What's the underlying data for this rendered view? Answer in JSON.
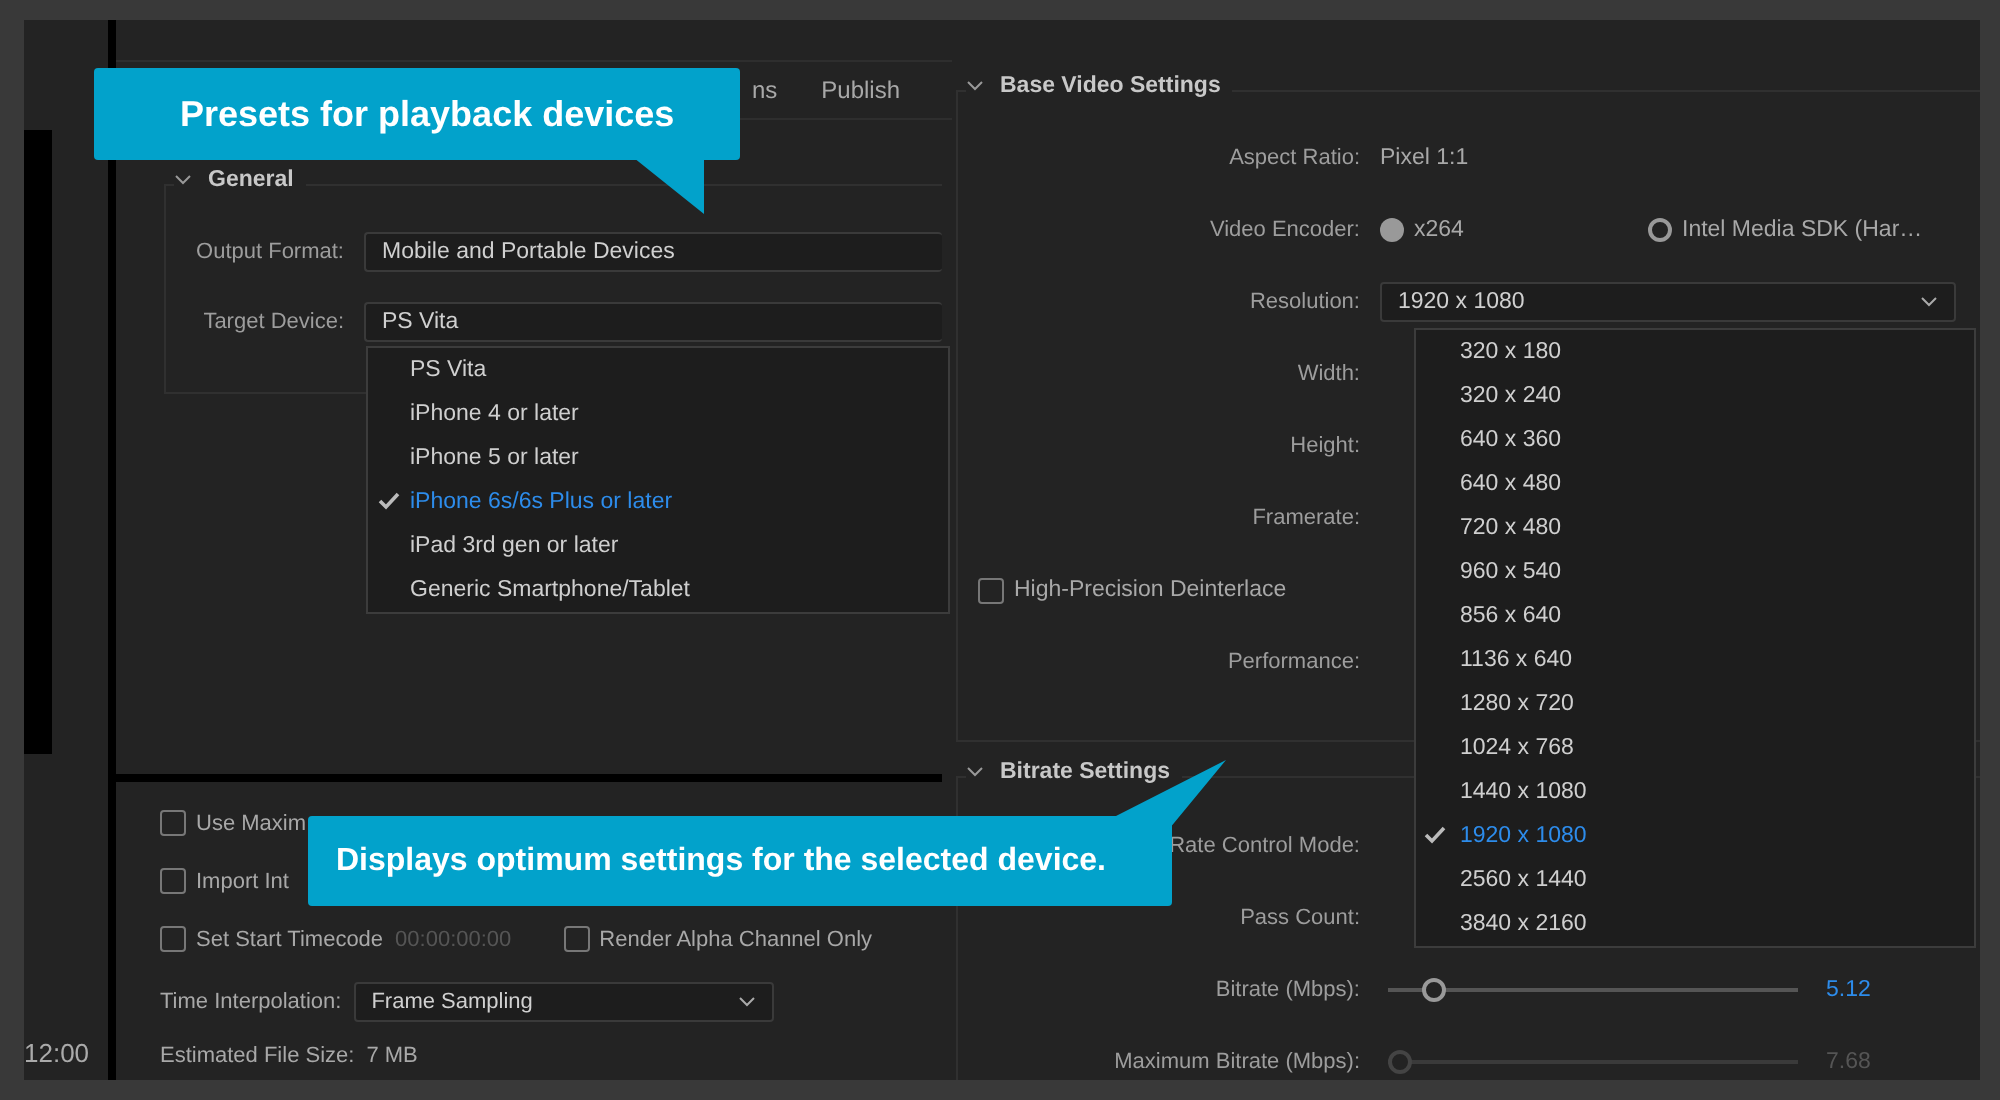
{
  "tabs": [
    {
      "label": "ns"
    },
    {
      "label": "Publish"
    }
  ],
  "general": {
    "title": "General",
    "expanded": true,
    "rows": [
      {
        "label": "Output Format:",
        "value": "Mobile and Portable Devices"
      },
      {
        "label": "Target Device:",
        "value": "PS Vita"
      }
    ]
  },
  "device_menu": [
    {
      "label": "PS Vita",
      "selected": false
    },
    {
      "label": "iPhone 4 or later",
      "selected": false
    },
    {
      "label": "iPhone 5 or later",
      "selected": false
    },
    {
      "label": "iPhone 6s/6s Plus or later",
      "selected": true
    },
    {
      "label": "iPad 3rd gen or later",
      "selected": false
    },
    {
      "label": "Generic Smartphone/Tablet",
      "selected": false
    }
  ],
  "export_options": [
    {
      "label": "Use Maxim",
      "checked": false
    },
    {
      "label": "Import Int",
      "checked": false
    },
    {
      "label": "Set Start Timecode",
      "checked": false,
      "value": "00:00:00:00"
    },
    {
      "label": "Render Alpha Channel Only",
      "checked": false
    }
  ],
  "time_interpolation": {
    "label": "Time Interpolation:",
    "value": "Frame Sampling"
  },
  "estimated_file_size": {
    "label": "Estimated File Size:",
    "value": "7 MB"
  },
  "timecode": "12:00",
  "video": {
    "title": "Base Video Settings",
    "expanded": true,
    "rows": [
      {
        "kind": "text",
        "label": "Aspect Ratio:",
        "value": "Pixel 1:1"
      },
      {
        "kind": "radio",
        "label": "Video Encoder:",
        "options": [
          {
            "label": "x264",
            "selected": true
          },
          {
            "label": "Intel Media SDK (Har…",
            "selected": false
          }
        ]
      },
      {
        "kind": "select",
        "label": "Resolution:",
        "value": "1920 x 1080"
      },
      {
        "kind": "blank",
        "label": "Width:"
      },
      {
        "kind": "blank",
        "label": "Height:"
      },
      {
        "kind": "blank",
        "label": "Framerate:"
      },
      {
        "kind": "checkbox",
        "label": "High-Precision Deinterlace",
        "checked": false
      },
      {
        "kind": "blank",
        "label": "Performance:"
      }
    ]
  },
  "resolution_menu": [
    {
      "label": "320 x 180",
      "selected": false
    },
    {
      "label": "320 x 240",
      "selected": false
    },
    {
      "label": "640 x 360",
      "selected": false
    },
    {
      "label": "640 x 480",
      "selected": false
    },
    {
      "label": "720 x 480",
      "selected": false
    },
    {
      "label": "960 x 540",
      "selected": false
    },
    {
      "label": "856 x 640",
      "selected": false
    },
    {
      "label": "1136 x 640",
      "selected": false
    },
    {
      "label": "1280 x 720",
      "selected": false
    },
    {
      "label": "1024 x 768",
      "selected": false
    },
    {
      "label": "1440 x 1080",
      "selected": false
    },
    {
      "label": "1920 x 1080",
      "selected": true
    },
    {
      "label": "2560 x 1440",
      "selected": false
    },
    {
      "label": "3840 x 2160",
      "selected": false
    }
  ],
  "bitrate": {
    "title": "Bitrate Settings",
    "expanded": true,
    "rows": [
      {
        "kind": "blank",
        "label": "Rate Control Mode:"
      },
      {
        "kind": "blank",
        "label": "Pass Count:"
      },
      {
        "kind": "slider",
        "label": "Bitrate (Mbps):",
        "level": 0.09,
        "reading": "5.12",
        "disabled": false
      },
      {
        "kind": "slider",
        "label": "Maximum Bitrate (Mbps):",
        "level": 0,
        "reading": "7.68",
        "disabled": true
      }
    ]
  },
  "callouts": [
    {
      "text": "Presets for playback devices"
    },
    {
      "text": "Displays optimum settings for the selected device."
    }
  ]
}
